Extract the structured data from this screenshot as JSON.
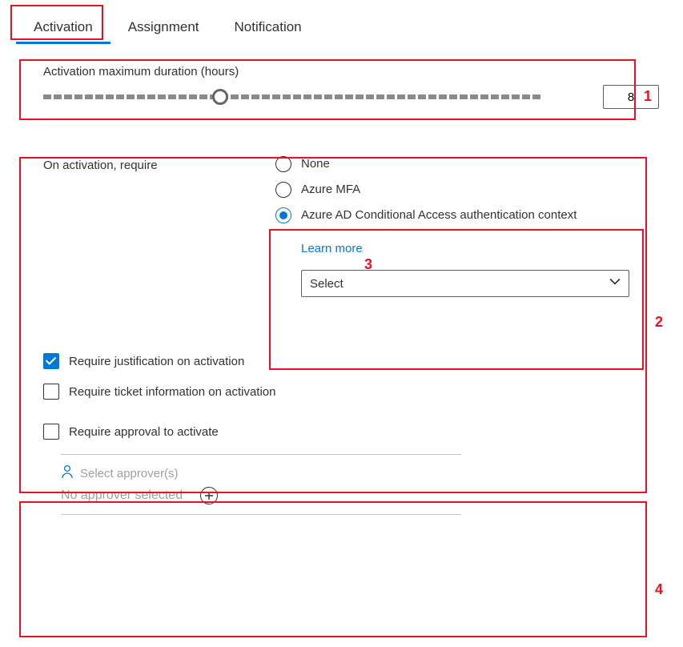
{
  "tabs": {
    "t0": "Activation",
    "t1": "Assignment",
    "t2": "Notification"
  },
  "duration": {
    "label": "Activation maximum duration (hours)",
    "value": "8"
  },
  "require": {
    "label": "On activation, require",
    "none": "None",
    "mfa": "Azure MFA",
    "ca": "Azure AD Conditional Access authentication context",
    "learn": "Learn more",
    "select_placeholder": "Select"
  },
  "checks": {
    "justification": "Require justification on activation",
    "ticket": "Require ticket information on activation",
    "approval": "Require approval to activate"
  },
  "approvers": {
    "head": "Select approver(s)",
    "status": "No approver selected"
  },
  "callouts": {
    "n1": "1",
    "n2": "2",
    "n3": "3",
    "n4": "4"
  }
}
